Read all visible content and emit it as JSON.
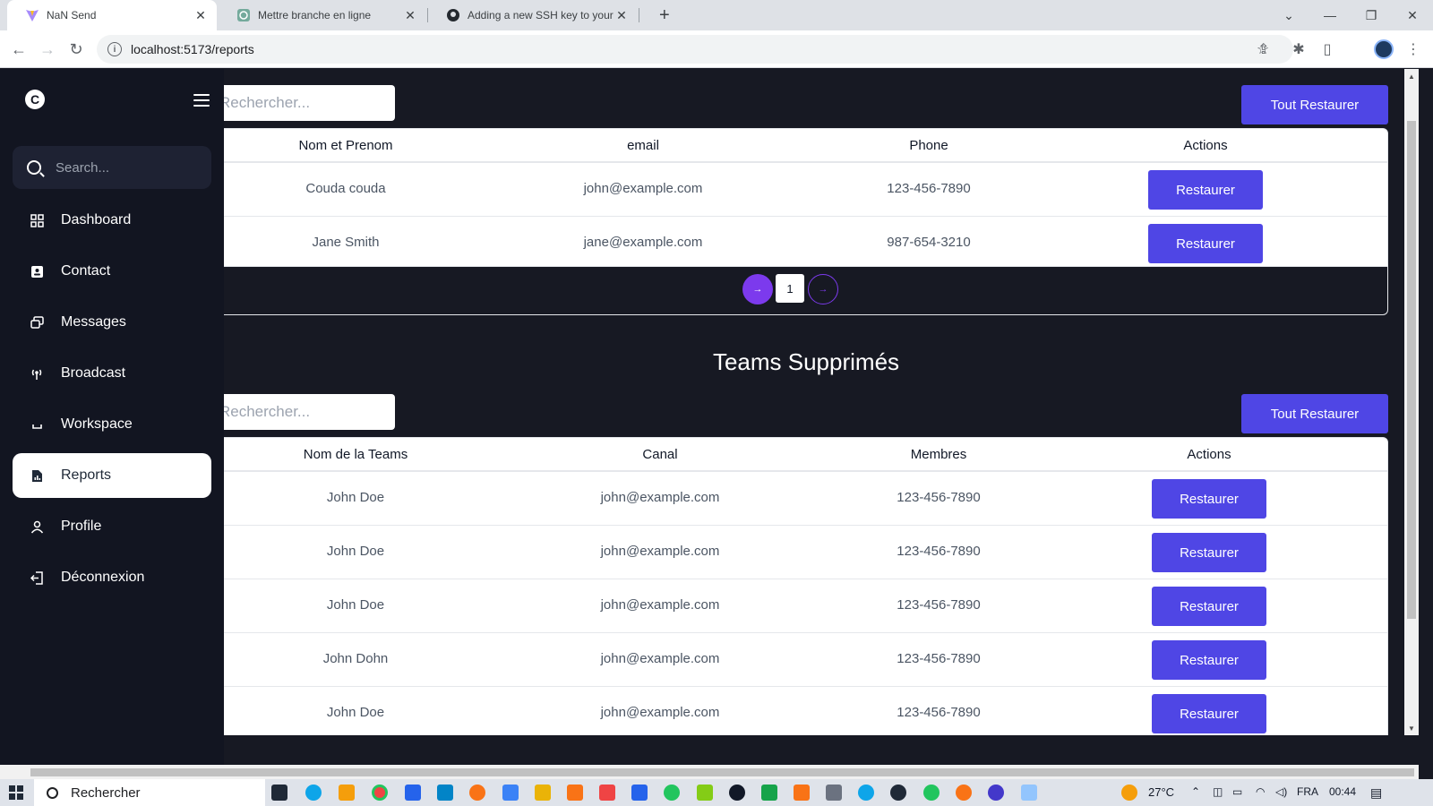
{
  "browser": {
    "tabs": [
      {
        "title": "NaN Send",
        "active": true
      },
      {
        "title": "Mettre branche en ligne",
        "active": false
      },
      {
        "title": "Adding a new SSH key to your G",
        "active": false
      }
    ],
    "url": "localhost:5173/reports"
  },
  "sidebar": {
    "search_placeholder": "Search...",
    "items": [
      {
        "label": "Dashboard",
        "icon": "dashboard-icon"
      },
      {
        "label": "Contact",
        "icon": "contact-icon"
      },
      {
        "label": "Messages",
        "icon": "messages-icon"
      },
      {
        "label": "Broadcast",
        "icon": "broadcast-icon"
      },
      {
        "label": "Workspace",
        "icon": "workspace-icon"
      },
      {
        "label": "Reports",
        "icon": "reports-icon",
        "active": true
      },
      {
        "label": "Profile",
        "icon": "profile-icon"
      },
      {
        "label": "Déconnexion",
        "icon": "logout-icon"
      }
    ]
  },
  "contacts_section": {
    "search_placeholder": "Rechercher...",
    "restore_all_label": "Tout Restaurer",
    "columns": [
      "Nom et Prenom",
      "email",
      "Phone",
      "Actions"
    ],
    "rows": [
      {
        "name": "Couda couda",
        "email": "john@example.com",
        "phone": "123-456-7890",
        "action": "Restaurer"
      },
      {
        "name": "Jane Smith",
        "email": "jane@example.com",
        "phone": "987-654-3210",
        "action": "Restaurer"
      }
    ],
    "pagination": {
      "prev": "→",
      "page": "1",
      "next": "→"
    }
  },
  "teams_section": {
    "title": "Teams Supprimés",
    "search_placeholder": "Rechercher...",
    "restore_all_label": "Tout Restaurer",
    "columns": [
      "Nom de la Teams",
      "Canal",
      "Membres",
      "Actions"
    ],
    "rows": [
      {
        "name": "John Doe",
        "canal": "john@example.com",
        "membres": "123-456-7890",
        "action": "Restaurer"
      },
      {
        "name": "John Doe",
        "canal": "john@example.com",
        "membres": "123-456-7890",
        "action": "Restaurer"
      },
      {
        "name": "John Doe",
        "canal": "john@example.com",
        "membres": "123-456-7890",
        "action": "Restaurer"
      },
      {
        "name": "John Dohn",
        "canal": "john@example.com",
        "membres": "123-456-7890",
        "action": "Restaurer"
      },
      {
        "name": "John Doe",
        "canal": "john@example.com",
        "membres": "123-456-7890",
        "action": "Restaurer"
      }
    ]
  },
  "taskbar": {
    "search_label": "Rechercher",
    "temperature": "27°C",
    "language": "FRA",
    "time": "00:44"
  },
  "colors": {
    "sidebar_bg": "#121521",
    "main_bg": "#171923",
    "accent": "#4f46e5",
    "pager_accent": "#7c3aed"
  }
}
